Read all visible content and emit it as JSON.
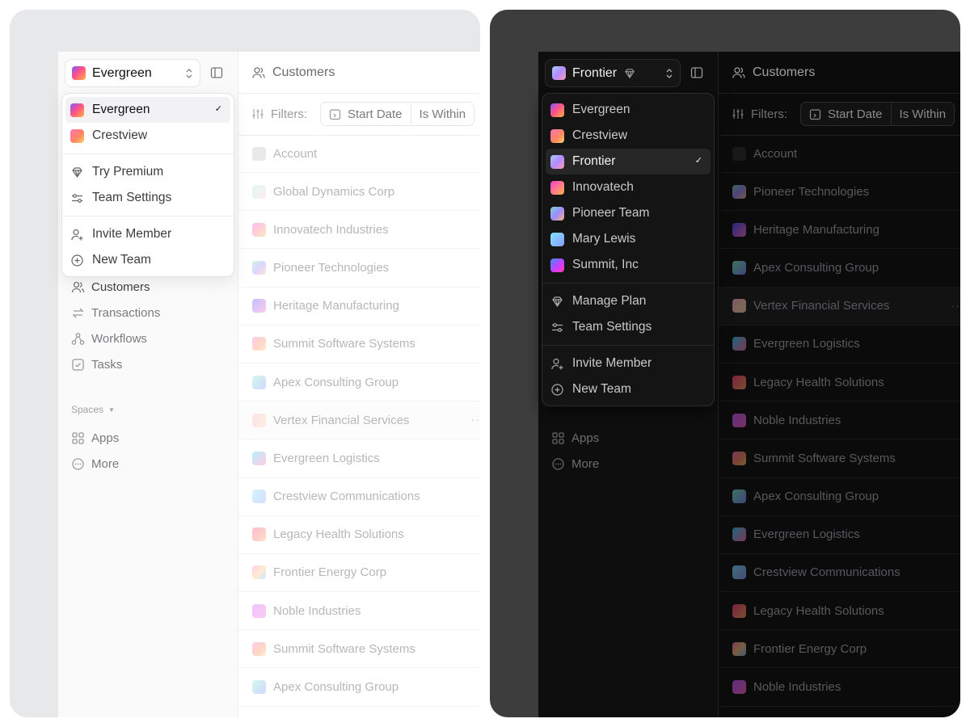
{
  "light": {
    "team_switcher": {
      "current": "Evergreen"
    },
    "dropdown": {
      "teams": [
        {
          "name": "Evergreen",
          "selected": true
        },
        {
          "name": "Crestview",
          "selected": false
        }
      ],
      "group2": [
        "Try Premium",
        "Team Settings"
      ],
      "group3": [
        "Invite Member",
        "New Team"
      ]
    },
    "nav": [
      "Customers",
      "Transactions",
      "Workflows",
      "Tasks"
    ],
    "spaces_label": "Spaces",
    "spaces_items": [
      "Apps",
      "More"
    ],
    "header": "Customers",
    "filters": {
      "label": "Filters:",
      "field": "Start Date",
      "op": "Is Within"
    },
    "account_header": "Account",
    "rows": [
      "Global Dynamics Corp",
      "Innovatech Industries",
      "Pioneer Technologies",
      "Heritage Manufacturing",
      "Summit Software Systems",
      "Apex Consulting Group",
      "Vertex Financial Services",
      "Evergreen Logistics",
      "Crestview Communications",
      "Legacy Health Solutions",
      "Frontier Energy Corp",
      "Noble Industries",
      "Summit Software Systems",
      "Apex Consulting Group"
    ],
    "row_more": "··"
  },
  "dark": {
    "team_switcher": {
      "current": "Frontier"
    },
    "dropdown": {
      "teams": [
        {
          "name": "Evergreen",
          "selected": false
        },
        {
          "name": "Crestview",
          "selected": false
        },
        {
          "name": "Frontier",
          "selected": true
        },
        {
          "name": "Innovatech",
          "selected": false
        },
        {
          "name": "Pioneer Team",
          "selected": false
        },
        {
          "name": "Mary Lewis",
          "selected": false
        },
        {
          "name": "Summit, Inc",
          "selected": false
        }
      ],
      "group2": [
        "Manage Plan",
        "Team Settings"
      ],
      "group3": [
        "Invite Member",
        "New Team"
      ]
    },
    "spaces_items": [
      "Apps",
      "More"
    ],
    "header": "Customers",
    "filters": {
      "label": "Filters:",
      "field": "Start Date",
      "op": "Is Within"
    },
    "account_header": "Account",
    "rows": [
      "Pioneer Technologies",
      "Heritage Manufacturing",
      "Apex Consulting Group",
      "Vertex Financial Services",
      "Evergreen Logistics",
      "Legacy Health Solutions",
      "Noble Industries",
      "Summit Software Systems",
      "Apex Consulting Group",
      "Evergreen Logistics",
      "Crestview Communications",
      "Legacy Health Solutions",
      "Frontier Energy Corp",
      "Noble Industries"
    ],
    "row_more": "··"
  },
  "icons": {
    "check": "✓",
    "spaces_caret": "▼"
  }
}
